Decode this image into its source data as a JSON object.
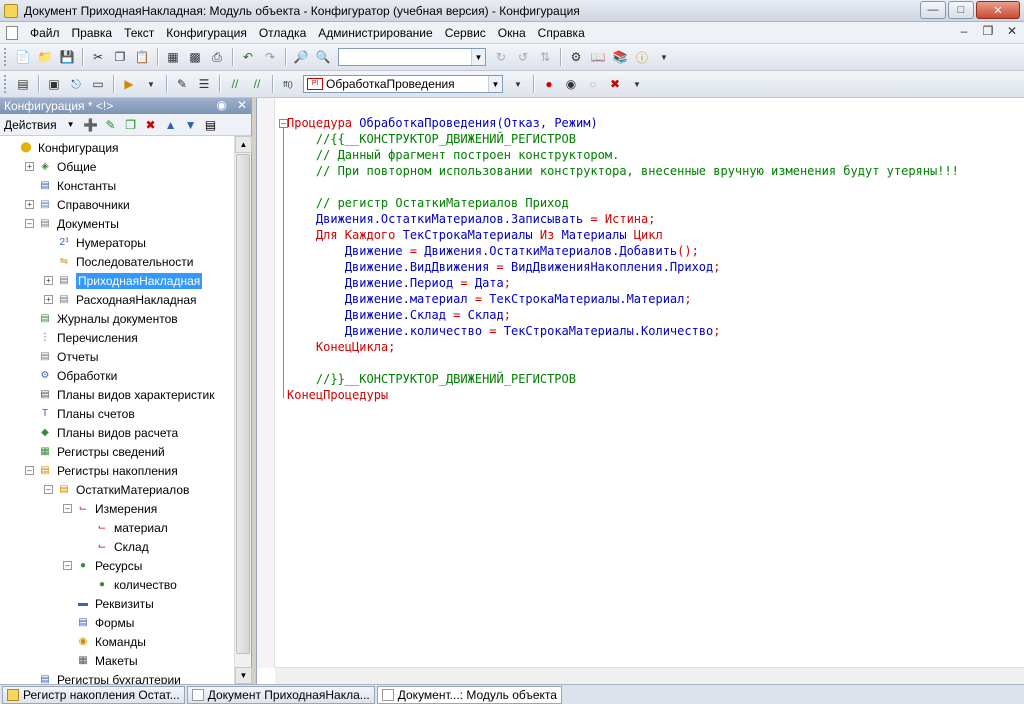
{
  "window": {
    "title": "Документ ПриходнаяНакладная: Модуль объекта - Конфигуратор (учебная версия) - Конфигурация"
  },
  "menu": {
    "items": [
      "Файл",
      "Правка",
      "Текст",
      "Конфигурация",
      "Отладка",
      "Администрирование",
      "Сервис",
      "Окна",
      "Справка"
    ]
  },
  "toolbar": {
    "search_value": "",
    "procedure_select": "ОбработкаПроведения"
  },
  "config_panel": {
    "title": "Конфигурация * <!>",
    "actions_label": "Действия"
  },
  "tree": {
    "items": [
      {
        "label": "Конфигурация",
        "level": 0,
        "expander": "none",
        "icon": "config-icon"
      },
      {
        "label": "Общие",
        "level": 1,
        "expander": "+",
        "icon": "common-icon"
      },
      {
        "label": "Константы",
        "level": 1,
        "expander": "none",
        "icon": "constants-icon"
      },
      {
        "label": "Справочники",
        "level": 1,
        "expander": "+",
        "icon": "catalogs-icon"
      },
      {
        "label": "Документы",
        "level": 1,
        "expander": "-",
        "icon": "documents-icon"
      },
      {
        "label": "Нумераторы",
        "level": 2,
        "expander": "none",
        "icon": "numerators-icon"
      },
      {
        "label": "Последовательности",
        "level": 2,
        "expander": "none",
        "icon": "sequences-icon"
      },
      {
        "label": "ПриходнаяНакладная",
        "level": 2,
        "expander": "+",
        "icon": "document-icon",
        "selected": true
      },
      {
        "label": "РасходнаяНакладная",
        "level": 2,
        "expander": "+",
        "icon": "document-icon"
      },
      {
        "label": "Журналы документов",
        "level": 1,
        "expander": "none",
        "icon": "journals-icon"
      },
      {
        "label": "Перечисления",
        "level": 1,
        "expander": "none",
        "icon": "enums-icon"
      },
      {
        "label": "Отчеты",
        "level": 1,
        "expander": "none",
        "icon": "reports-icon"
      },
      {
        "label": "Обработки",
        "level": 1,
        "expander": "none",
        "icon": "processing-icon"
      },
      {
        "label": "Планы видов характеристик",
        "level": 1,
        "expander": "none",
        "icon": "chart-char-icon"
      },
      {
        "label": "Планы счетов",
        "level": 1,
        "expander": "none",
        "icon": "chart-accounts-icon"
      },
      {
        "label": "Планы видов расчета",
        "level": 1,
        "expander": "none",
        "icon": "chart-calc-icon"
      },
      {
        "label": "Регистры сведений",
        "level": 1,
        "expander": "none",
        "icon": "info-registers-icon"
      },
      {
        "label": "Регистры накопления",
        "level": 1,
        "expander": "-",
        "icon": "accum-registers-icon"
      },
      {
        "label": "ОстаткиМатериалов",
        "level": 2,
        "expander": "-",
        "icon": "register-icon"
      },
      {
        "label": "Измерения",
        "level": 3,
        "expander": "-",
        "icon": "dimensions-icon"
      },
      {
        "label": "материал",
        "level": 4,
        "expander": "none",
        "icon": "dimension-icon"
      },
      {
        "label": "Склад",
        "level": 4,
        "expander": "none",
        "icon": "dimension-icon"
      },
      {
        "label": "Ресурсы",
        "level": 3,
        "expander": "-",
        "icon": "resources-icon"
      },
      {
        "label": "количество",
        "level": 4,
        "expander": "none",
        "icon": "resource-icon"
      },
      {
        "label": "Реквизиты",
        "level": 3,
        "expander": "none",
        "icon": "attributes-icon"
      },
      {
        "label": "Формы",
        "level": 3,
        "expander": "none",
        "icon": "forms-icon"
      },
      {
        "label": "Команды",
        "level": 3,
        "expander": "none",
        "icon": "commands-icon"
      },
      {
        "label": "Макеты",
        "level": 3,
        "expander": "none",
        "icon": "templates-icon"
      },
      {
        "label": "Регистры бухгалтерии",
        "level": 1,
        "expander": "none",
        "icon": "accounting-registers-icon"
      }
    ]
  },
  "code": {
    "lines": [
      [
        [
          "kw",
          "Процедура "
        ],
        [
          "id",
          "ОбработкаПроведения(Отказ, Режим)"
        ]
      ],
      [
        [
          "cm",
          "    //{{__КОНСТРУКТОР_ДВИЖЕНИЙ_РЕГИСТРОВ"
        ]
      ],
      [
        [
          "cm",
          "    // Данный фрагмент построен конструктором."
        ]
      ],
      [
        [
          "cm",
          "    // При повторном использовании конструктора, внесенные вручную изменения будут утеряны!!!"
        ]
      ],
      [
        [
          "cm",
          ""
        ]
      ],
      [
        [
          "cm",
          "    // регистр ОстаткиМатериалов Приход"
        ]
      ],
      [
        [
          "id",
          "    Движения.ОстаткиМатериалов.Записывать "
        ],
        [
          "op",
          "= "
        ],
        [
          "kw",
          "Истина"
        ],
        [
          "op",
          ";"
        ]
      ],
      [
        [
          "kw",
          "    Для Каждого "
        ],
        [
          "id",
          "ТекСтрокаМатериалы "
        ],
        [
          "kw",
          "Из "
        ],
        [
          "id",
          "Материалы "
        ],
        [
          "kw",
          "Цикл"
        ]
      ],
      [
        [
          "id",
          "        Движение "
        ],
        [
          "op",
          "= "
        ],
        [
          "id",
          "Движения.ОстаткиМатериалов.Добавить"
        ],
        [
          "op",
          "();"
        ]
      ],
      [
        [
          "id",
          "        Движение.ВидДвижения "
        ],
        [
          "op",
          "= "
        ],
        [
          "id",
          "ВидДвиженияНакопления.Приход"
        ],
        [
          "op",
          ";"
        ]
      ],
      [
        [
          "id",
          "        Движение.Период "
        ],
        [
          "op",
          "= "
        ],
        [
          "id",
          "Дата"
        ],
        [
          "op",
          ";"
        ]
      ],
      [
        [
          "id",
          "        Движение.материал "
        ],
        [
          "op",
          "= "
        ],
        [
          "id",
          "ТекСтрокаМатериалы.Материал"
        ],
        [
          "op",
          ";"
        ]
      ],
      [
        [
          "id",
          "        Движение.Склад "
        ],
        [
          "op",
          "= "
        ],
        [
          "id",
          "Склад"
        ],
        [
          "op",
          ";"
        ]
      ],
      [
        [
          "id",
          "        Движение.количество "
        ],
        [
          "op",
          "= "
        ],
        [
          "id",
          "ТекСтрокаМатериалы.Количество"
        ],
        [
          "op",
          ";"
        ]
      ],
      [
        [
          "kw",
          "    КонецЦикла"
        ],
        [
          "op",
          ";"
        ]
      ],
      [
        [
          "cm",
          ""
        ]
      ],
      [
        [
          "cm",
          "    //}}__КОНСТРУКТОР_ДВИЖЕНИЙ_РЕГИСТРОВ"
        ]
      ],
      [
        [
          "kw",
          "КонецПроцедуры"
        ]
      ]
    ]
  },
  "window_tabs": [
    {
      "label": "Регистр накопления Остат...",
      "icon": "reg",
      "active": false
    },
    {
      "label": "Документ ПриходнаяНакла...",
      "icon": "doc",
      "active": false
    },
    {
      "label": "Документ...: Модуль объекта",
      "icon": "doc",
      "active": true
    }
  ]
}
